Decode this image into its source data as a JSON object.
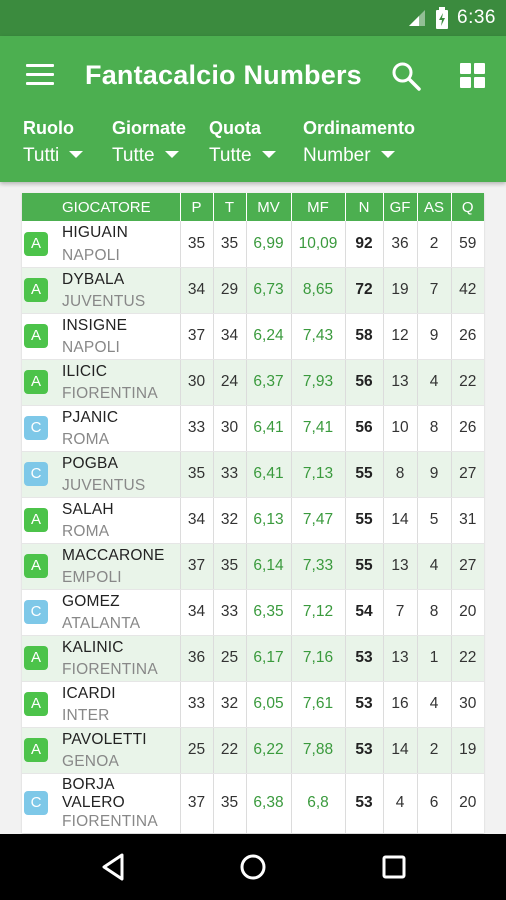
{
  "status": {
    "time": "6:36"
  },
  "app": {
    "title": "Fantacalcio Numbers"
  },
  "filters": [
    {
      "label": "Ruolo",
      "value": "Tutti"
    },
    {
      "label": "Giornate",
      "value": "Tutte"
    },
    {
      "label": "Quota",
      "value": "Tutte"
    },
    {
      "label": "Ordinamento",
      "value": "Number"
    }
  ],
  "table": {
    "columns": [
      "GIOCATORE",
      "P",
      "T",
      "MV",
      "MF",
      "N",
      "GF",
      "AS",
      "Q"
    ],
    "rows": [
      {
        "role": "A",
        "name": "HIGUAIN",
        "team": "NAPOLI",
        "p": "35",
        "t": "35",
        "mv": "6,99",
        "mf": "10,09",
        "n": "92",
        "gf": "36",
        "as": "2",
        "q": "59"
      },
      {
        "role": "A",
        "name": "DYBALA",
        "team": "JUVENTUS",
        "p": "34",
        "t": "29",
        "mv": "6,73",
        "mf": "8,65",
        "n": "72",
        "gf": "19",
        "as": "7",
        "q": "42"
      },
      {
        "role": "A",
        "name": "INSIGNE",
        "team": "NAPOLI",
        "p": "37",
        "t": "34",
        "mv": "6,24",
        "mf": "7,43",
        "n": "58",
        "gf": "12",
        "as": "9",
        "q": "26"
      },
      {
        "role": "A",
        "name": "ILICIC",
        "team": "FIORENTINA",
        "p": "30",
        "t": "24",
        "mv": "6,37",
        "mf": "7,93",
        "n": "56",
        "gf": "13",
        "as": "4",
        "q": "22"
      },
      {
        "role": "C",
        "name": "PJANIC",
        "team": "ROMA",
        "p": "33",
        "t": "30",
        "mv": "6,41",
        "mf": "7,41",
        "n": "56",
        "gf": "10",
        "as": "8",
        "q": "26"
      },
      {
        "role": "C",
        "name": "POGBA",
        "team": "JUVENTUS",
        "p": "35",
        "t": "33",
        "mv": "6,41",
        "mf": "7,13",
        "n": "55",
        "gf": "8",
        "as": "9",
        "q": "27"
      },
      {
        "role": "A",
        "name": "SALAH",
        "team": "ROMA",
        "p": "34",
        "t": "32",
        "mv": "6,13",
        "mf": "7,47",
        "n": "55",
        "gf": "14",
        "as": "5",
        "q": "31"
      },
      {
        "role": "A",
        "name": "MACCARONE",
        "team": "EMPOLI",
        "p": "37",
        "t": "35",
        "mv": "6,14",
        "mf": "7,33",
        "n": "55",
        "gf": "13",
        "as": "4",
        "q": "27"
      },
      {
        "role": "C",
        "name": "GOMEZ",
        "team": "ATALANTA",
        "p": "34",
        "t": "33",
        "mv": "6,35",
        "mf": "7,12",
        "n": "54",
        "gf": "7",
        "as": "8",
        "q": "20"
      },
      {
        "role": "A",
        "name": "KALINIC",
        "team": "FIORENTINA",
        "p": "36",
        "t": "25",
        "mv": "6,17",
        "mf": "7,16",
        "n": "53",
        "gf": "13",
        "as": "1",
        "q": "22"
      },
      {
        "role": "A",
        "name": "ICARDI",
        "team": "INTER",
        "p": "33",
        "t": "32",
        "mv": "6,05",
        "mf": "7,61",
        "n": "53",
        "gf": "16",
        "as": "4",
        "q": "30"
      },
      {
        "role": "A",
        "name": "PAVOLETTI",
        "team": "GENOA",
        "p": "25",
        "t": "22",
        "mv": "6,22",
        "mf": "7,88",
        "n": "53",
        "gf": "14",
        "as": "2",
        "q": "19"
      },
      {
        "role": "C",
        "name": "BORJA VALERO",
        "team": "FIORENTINA",
        "p": "37",
        "t": "35",
        "mv": "6,38",
        "mf": "6,8",
        "n": "53",
        "gf": "4",
        "as": "6",
        "q": "20"
      }
    ]
  },
  "colors": {
    "primary": "#4caf50",
    "status_bar": "#3b8b3e",
    "role_A": "#4cc34a",
    "role_C": "#7ec8e8",
    "alt_row": "#e9f4e9"
  }
}
